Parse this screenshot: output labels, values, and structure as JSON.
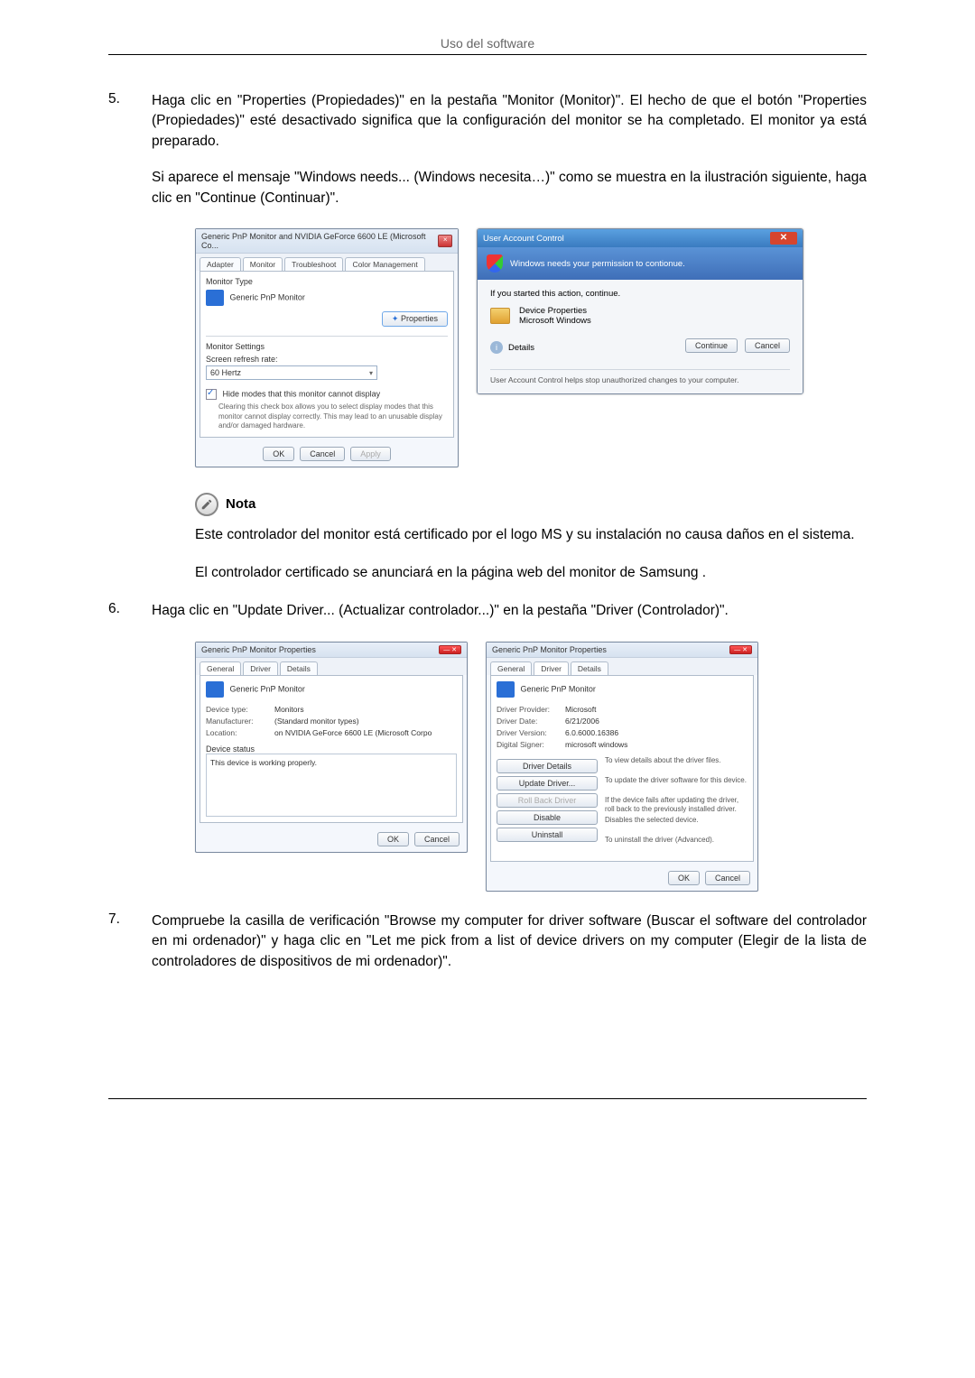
{
  "header": {
    "title": "Uso del software"
  },
  "steps": {
    "s5": {
      "num": "5.",
      "p1": "Haga clic en \"Properties (Propiedades)\" en la pestaña \"Monitor (Monitor)\". El hecho de que el botón \"Properties (Propiedades)\" esté desactivado significa que la configuración del monitor se ha completado. El monitor ya está preparado.",
      "p2": "Si aparece el mensaje \"Windows needs... (Windows necesita…)\" como se muestra en la ilustración siguiente, haga clic en \"Continue (Continuar)\"."
    },
    "s6": {
      "num": "6.",
      "p1": "Haga clic en \"Update Driver... (Actualizar controlador...)\" en la pestaña \"Driver (Controlador)\"."
    },
    "s7": {
      "num": "7.",
      "p1": "Compruebe la casilla de verificación \"Browse my computer for driver software (Buscar el software del controlador en mi ordenador)\" y haga clic en \"Let me pick from a list of device drivers on my computer (Elegir de la lista de controladores de dispositivos de mi ordenador)\"."
    }
  },
  "nota": {
    "label": "Nota",
    "p1": "Este controlador del monitor está certificado por el logo MS y su instalación no causa daños en el sistema.",
    "p2": "El controlador certificado se anunciará en la página web del monitor de Samsung ."
  },
  "fig1_left": {
    "title": "Generic PnP Monitor and NVIDIA GeForce 6600 LE (Microsoft Co...",
    "tabs": [
      "Adapter",
      "Monitor",
      "Troubleshoot",
      "Color Management"
    ],
    "section1": "Monitor Type",
    "monitor_name": "Generic PnP Monitor",
    "properties_btn": "Properties",
    "section2": "Monitor Settings",
    "refresh_lbl": "Screen refresh rate:",
    "refresh_val": "60 Hertz",
    "hide_chk": "Hide modes that this monitor cannot display",
    "hide_desc": "Clearing this check box allows you to select display modes that this monitor cannot display correctly. This may lead to an unusable display and/or damaged hardware.",
    "ok": "OK",
    "cancel": "Cancel",
    "apply": "Apply"
  },
  "uac": {
    "title": "User Account Control",
    "band": "Windows needs your permission to contionue.",
    "started": "If you started this action, continue.",
    "prog1": "Device Properties",
    "prog2": "Microsoft Windows",
    "details": "Details",
    "continue": "Continue",
    "cancel": "Cancel",
    "foot": "User Account Control helps stop unauthorized changes to your computer."
  },
  "drv_general": {
    "title": "Generic PnP Monitor Properties",
    "tabs": [
      "General",
      "Driver",
      "Details"
    ],
    "name": "Generic PnP Monitor",
    "rows": {
      "type_l": "Device type:",
      "type_v": "Monitors",
      "manu_l": "Manufacturer:",
      "manu_v": "(Standard monitor types)",
      "loc_l": "Location:",
      "loc_v": "on NVIDIA GeForce 6600 LE (Microsoft Corpo"
    },
    "status_lbl": "Device status",
    "status_txt": "This device is working properly.",
    "ok": "OK",
    "cancel": "Cancel"
  },
  "drv_driver": {
    "title": "Generic PnP Monitor Properties",
    "tabs": [
      "General",
      "Driver",
      "Details"
    ],
    "name": "Generic PnP Monitor",
    "rows": {
      "prov_l": "Driver Provider:",
      "prov_v": "Microsoft",
      "date_l": "Driver Date:",
      "date_v": "6/21/2006",
      "ver_l": "Driver Version:",
      "ver_v": "6.0.6000.16386",
      "sign_l": "Digital Signer:",
      "sign_v": "microsoft windows"
    },
    "btns": {
      "details": "Driver Details",
      "details_d": "To view details about the driver files.",
      "update": "Update Driver...",
      "update_d": "To update the driver software for this device.",
      "rollback": "Roll Back Driver",
      "rollback_d": "If the device fails after updating the driver, roll back to the previously installed driver.",
      "disable": "Disable",
      "disable_d": "Disables the selected device.",
      "uninstall": "Uninstall",
      "uninstall_d": "To uninstall the driver (Advanced)."
    },
    "ok": "OK",
    "cancel": "Cancel"
  }
}
